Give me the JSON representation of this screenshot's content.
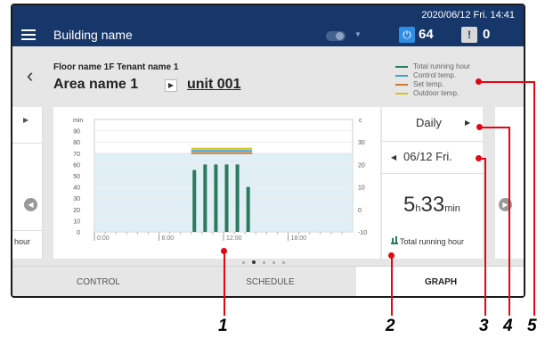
{
  "topbar": {
    "building_name": "Building name",
    "datetime": "2020/06/12 Fri. 14:41",
    "power_icon": "power-icon",
    "power_count": "64",
    "alert_icon": "warning-icon",
    "alert_count": "0"
  },
  "header": {
    "floor_tenant": "Floor name 1F Tenant name 1",
    "area_name": "Area name 1",
    "unit_name": "unit 001"
  },
  "legend": [
    {
      "label": "Total running hour",
      "color": "#2a7a5f"
    },
    {
      "label": "Control temp.",
      "color": "#3aa0d8"
    },
    {
      "label": "Set temp.",
      "color": "#d07a2a"
    },
    {
      "label": "Outdoor temp.",
      "color": "#d8c020"
    }
  ],
  "left_panel": {
    "partial_text": "hour"
  },
  "right_panel": {
    "period": "Daily",
    "date": "06/12 Fri.",
    "run_hours": "5",
    "run_hours_unit": "h",
    "run_minutes": "33",
    "run_minutes_unit": "min",
    "run_label": "Total running hour"
  },
  "tabs": [
    {
      "label": "CONTROL",
      "active": false
    },
    {
      "label": "SCHEDULE",
      "active": false
    },
    {
      "label": "GRAPH",
      "active": true
    }
  ],
  "callouts": [
    "1",
    "2",
    "3",
    "4",
    "5"
  ],
  "chart_data": {
    "type": "bar",
    "left_axis_unit": "min",
    "right_axis_unit": "c",
    "left_ticks": [
      "90",
      "80",
      "70",
      "60",
      "50",
      "40",
      "30",
      "20",
      "10",
      "0"
    ],
    "right_ticks": [
      "30",
      "20",
      "10",
      "0",
      "-10"
    ],
    "ylim_left": [
      0,
      100
    ],
    "ylim_right": [
      -10,
      40
    ],
    "x_ticks": [
      "0:00",
      "6:00",
      "12:00",
      "18:00"
    ],
    "hours": [
      9,
      10,
      11,
      12,
      13,
      14
    ],
    "running_minutes": [
      55,
      60,
      60,
      60,
      60,
      40
    ],
    "temps": {
      "control_temp": 26,
      "set_temp": 25,
      "outdoor_temp": 27
    },
    "band_range_min": [
      0,
      70
    ]
  }
}
